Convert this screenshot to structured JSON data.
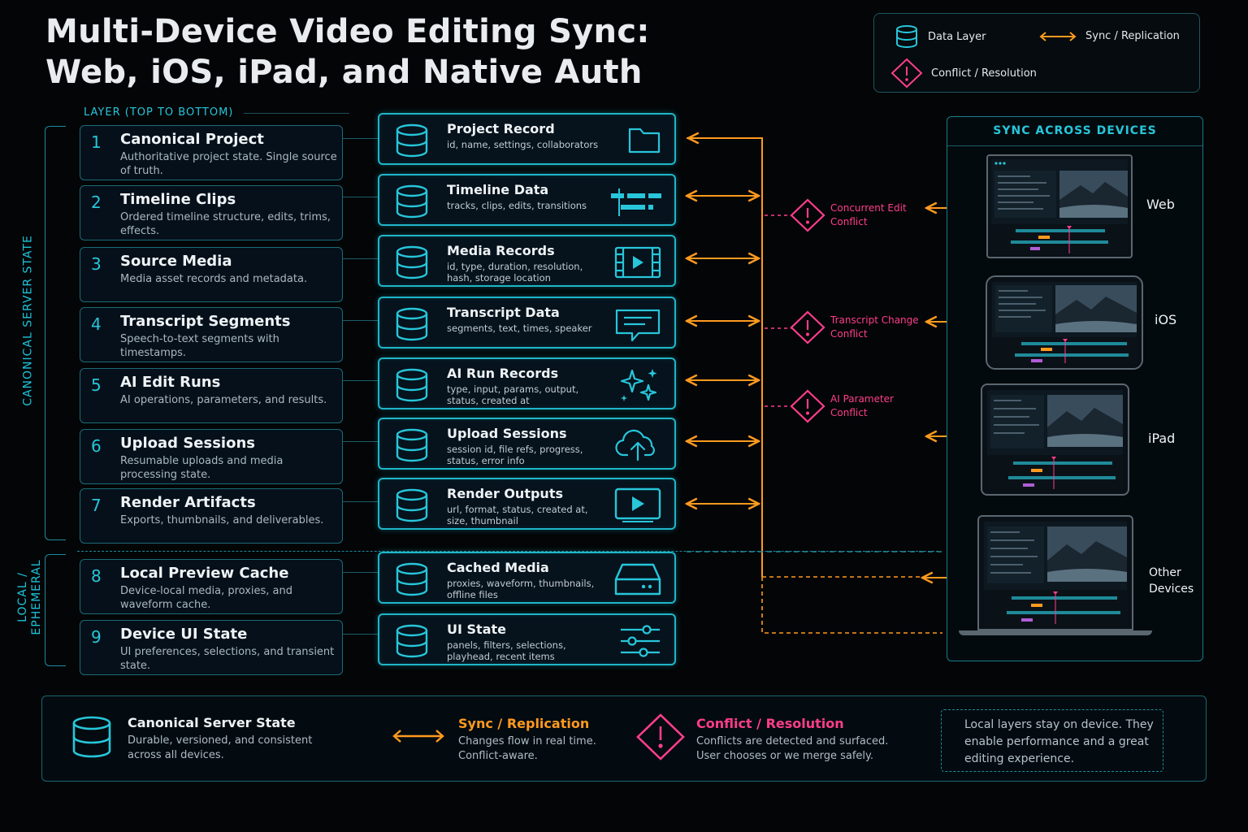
{
  "title": {
    "line1": "Multi-Device Video Editing Sync:",
    "line2": "Web, iOS, iPad, and Native Auth"
  },
  "legend": {
    "data_layer": "Data Layer",
    "sync": "Sync / Replication",
    "conflict": "Conflict / Resolution"
  },
  "layer_caption": "LAYER (TOP TO BOTTOM)",
  "side_labels": {
    "canonical": "CANONICAL SERVER STATE",
    "local_line1": "LOCAL /",
    "local_line2": "EPHEMERAL"
  },
  "layers": [
    {
      "num": "1",
      "name": "Canonical Project",
      "desc": "Authoritative project state. Single source of truth."
    },
    {
      "num": "2",
      "name": "Timeline Clips",
      "desc": "Ordered timeline structure, edits, trims, effects."
    },
    {
      "num": "3",
      "name": "Source Media",
      "desc": "Media asset records and metadata."
    },
    {
      "num": "4",
      "name": "Transcript Segments",
      "desc": "Speech-to-text segments with timestamps."
    },
    {
      "num": "5",
      "name": "AI Edit Runs",
      "desc": "AI operations, parameters, and results."
    },
    {
      "num": "6",
      "name": "Upload Sessions",
      "desc": "Resumable uploads and media processing state."
    },
    {
      "num": "7",
      "name": "Render Artifacts",
      "desc": "Exports, thumbnails, and deliverables."
    },
    {
      "num": "8",
      "name": "Local Preview Cache",
      "desc": "Device-local media, proxies, and waveform cache."
    },
    {
      "num": "9",
      "name": "Device UI State",
      "desc": "UI preferences, selections, and transient state."
    }
  ],
  "data_records": [
    {
      "name": "Project Record",
      "fields": "id, name, settings, collaborators",
      "icon": "folder-icon"
    },
    {
      "name": "Timeline Data",
      "fields": "tracks, clips, edits, transitions",
      "icon": "timeline-icon"
    },
    {
      "name": "Media Records",
      "fields": "id, type, duration, resolution, hash, storage location",
      "icon": "film-play-icon"
    },
    {
      "name": "Transcript Data",
      "fields": "segments, text, times, speaker",
      "icon": "chat-bubble-icon"
    },
    {
      "name": "AI Run Records",
      "fields": "type, input, params, output, status, created at",
      "icon": "sparkles-icon"
    },
    {
      "name": "Upload Sessions",
      "fields": "session id, file refs, progress, status, error info",
      "icon": "cloud-upload-icon"
    },
    {
      "name": "Render Outputs",
      "fields": "url, format, status, created at, size, thumbnail",
      "icon": "play-screen-icon"
    },
    {
      "name": "Cached Media",
      "fields": "proxies, waveform, thumbnails, offline files",
      "icon": "hard-drive-icon"
    },
    {
      "name": "UI State",
      "fields": "panels, filters, selections, playhead, recent items",
      "icon": "sliders-icon"
    }
  ],
  "conflicts": [
    {
      "label": "Concurrent Edit Conflict"
    },
    {
      "label": "Transcript Change Conflict"
    },
    {
      "label": "AI Parameter Conflict"
    }
  ],
  "sync_panel": {
    "title": "SYNC ACROSS DEVICES",
    "devices": [
      {
        "label": "Web"
      },
      {
        "label": "iOS"
      },
      {
        "label": "iPad"
      },
      {
        "label_line1": "Other",
        "label_line2": "Devices"
      }
    ]
  },
  "bottom_legend": {
    "canonical_title": "Canonical Server State",
    "canonical_desc": "Durable, versioned, and consistent across all devices.",
    "sync_title": "Sync / Replication",
    "sync_desc": "Changes flow in real time. Conflict-aware.",
    "conflict_title": "Conflict / Resolution",
    "conflict_desc": "Conflicts are detected and surfaced. User chooses or we merge safely.",
    "note": "Local  layers stay on device. They enable performance and a great editing experience."
  },
  "colors": {
    "cyan": "#1fb6c8",
    "orange": "#ff9a1f",
    "pink": "#ff3d8b",
    "background": "#030507"
  }
}
